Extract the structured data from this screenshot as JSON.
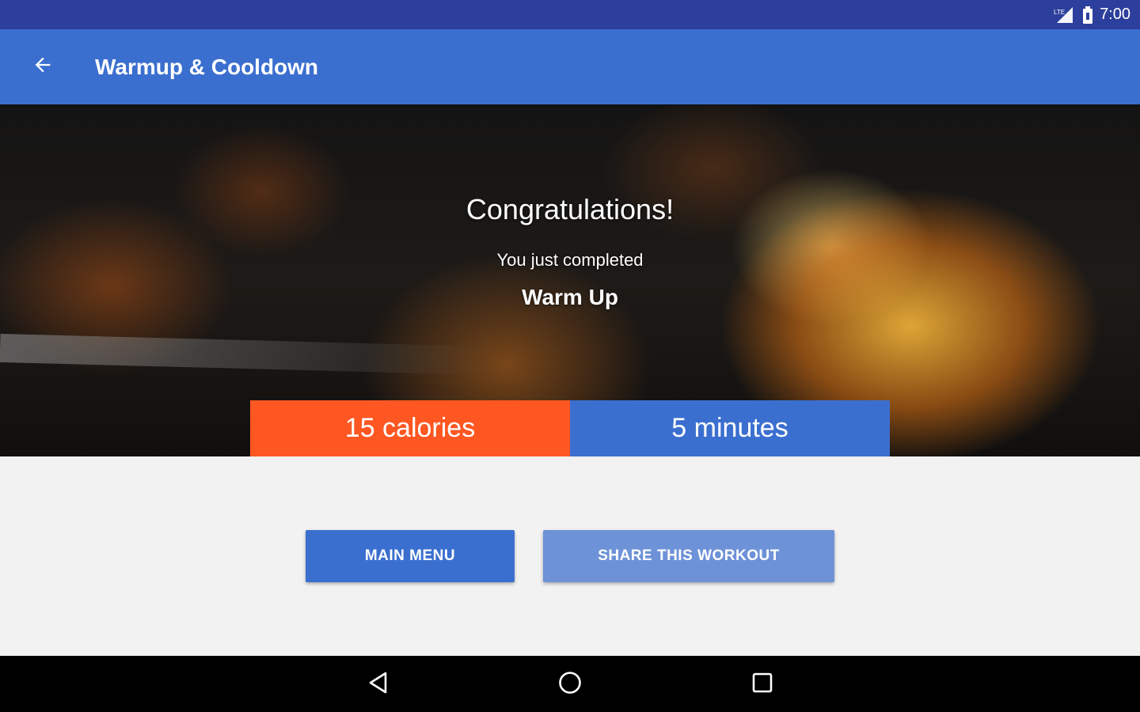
{
  "status_bar": {
    "time": "7:00",
    "icons": [
      "signal-icon",
      "battery-icon"
    ]
  },
  "app_bar": {
    "title": "Warmup & Cooldown",
    "back_icon": "arrow-back-icon"
  },
  "hero": {
    "congrats": "Congratulations!",
    "subtitle": "You just completed",
    "workout_name": "Warm Up",
    "calories": "15 calories",
    "minutes": "5 minutes"
  },
  "actions": {
    "main_menu": "MAIN MENU",
    "share": "SHARE THIS WORKOUT"
  },
  "nav_bar": {
    "icons": [
      "nav-back-icon",
      "nav-home-icon",
      "nav-recents-icon"
    ]
  },
  "colors": {
    "status_bar": "#2d3f9c",
    "app_bar": "#3b6fcf",
    "calories_tile": "#fe5722",
    "minutes_tile": "#3b6fcf",
    "share_button": "#6e92d8"
  }
}
